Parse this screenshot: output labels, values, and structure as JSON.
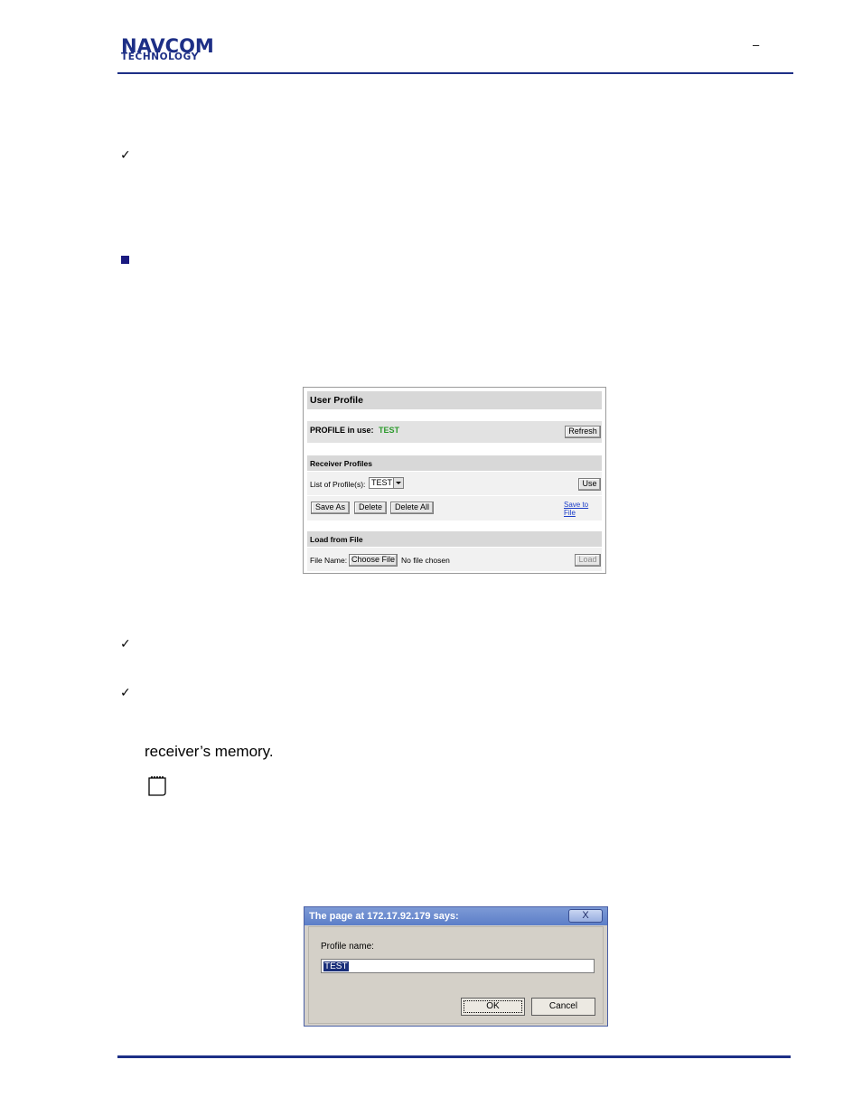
{
  "header": {
    "logo_line1": "NAVCOM",
    "logo_line2": "TECHNOLOGY",
    "dash": "–"
  },
  "bullets": {
    "check": "✓"
  },
  "body_text": "receiver’s memory.",
  "profile_panel": {
    "title": "User Profile",
    "in_use_label": "PROFILE in use:",
    "in_use_value": "TEST",
    "refresh_label": "Refresh",
    "receiver_profiles_header": "Receiver Profiles",
    "list_label": "List of Profile(s):",
    "list_selected": "TEST",
    "use_label": "Use",
    "save_as_label": "Save As",
    "delete_label": "Delete",
    "delete_all_label": "Delete All",
    "save_to_file_label": "Save to File",
    "load_from_file_header": "Load from File",
    "file_name_label": "File Name:",
    "choose_file_label": "Choose File",
    "no_file_label": "No file chosen",
    "load_label": "Load"
  },
  "dialog": {
    "title": "The page at 172.17.92.179 says:",
    "close_label": "X",
    "prompt_label": "Profile name:",
    "input_value": "TEST",
    "ok_label": "OK",
    "cancel_label": "Cancel"
  },
  "colors": {
    "brand_navy": "#1d2f86",
    "in_use_green": "#2c9a2c",
    "link_blue": "#1a3cc8"
  }
}
